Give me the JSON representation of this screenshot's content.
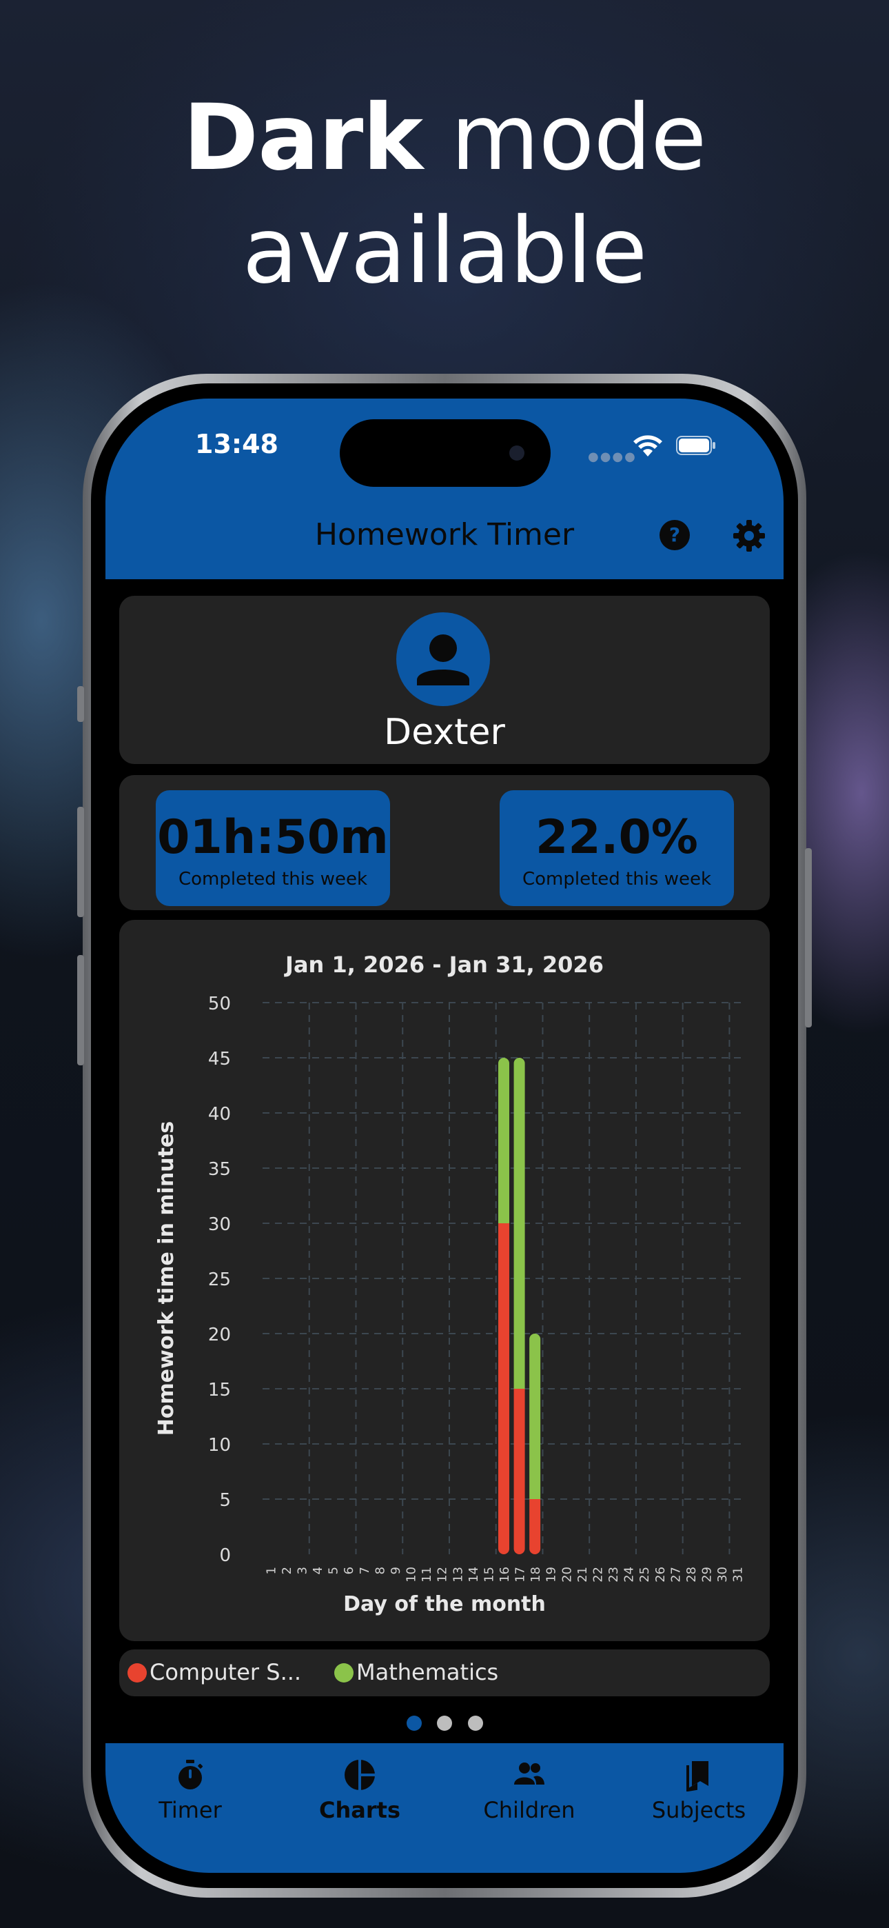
{
  "promo": {
    "headline_bold": "Dark",
    "headline_rest": " mode",
    "headline_line2": "available"
  },
  "status_bar": {
    "time": "13:48"
  },
  "header": {
    "title": "Homework Timer"
  },
  "profile": {
    "name": "Dexter"
  },
  "stats": [
    {
      "value": "01h:50m",
      "label": "Completed this week"
    },
    {
      "value": "22.0%",
      "label": "Completed this week"
    }
  ],
  "chart_data": {
    "type": "bar",
    "stacked": true,
    "title": "Jan 1, 2026 - Jan 31, 2026",
    "xlabel": "Day of the month",
    "ylabel": "Homework time in minutes",
    "ylim": [
      0,
      50
    ],
    "yticks": [
      0,
      5,
      10,
      15,
      20,
      25,
      30,
      35,
      40,
      45,
      50
    ],
    "categories": [
      "1",
      "2",
      "3",
      "4",
      "5",
      "6",
      "7",
      "8",
      "9",
      "10",
      "11",
      "12",
      "13",
      "14",
      "15",
      "16",
      "17",
      "18",
      "19",
      "20",
      "21",
      "22",
      "23",
      "24",
      "25",
      "26",
      "27",
      "28",
      "29",
      "30",
      "31"
    ],
    "series": [
      {
        "name": "Computer S...",
        "color": "#e8432f",
        "values": [
          0,
          0,
          0,
          0,
          0,
          0,
          0,
          0,
          0,
          0,
          0,
          0,
          0,
          0,
          0,
          30,
          15,
          5,
          0,
          0,
          0,
          0,
          0,
          0,
          0,
          0,
          0,
          0,
          0,
          0,
          0
        ]
      },
      {
        "name": "Mathematics",
        "color": "#8bc34a",
        "values": [
          0,
          0,
          0,
          0,
          0,
          0,
          0,
          0,
          0,
          0,
          0,
          0,
          0,
          0,
          0,
          15,
          30,
          15,
          0,
          0,
          0,
          0,
          0,
          0,
          0,
          0,
          0,
          0,
          0,
          0,
          0
        ]
      }
    ],
    "grid": true,
    "legend_position": "bottom"
  },
  "legend": [
    {
      "label": "Computer S...",
      "color": "#e8432f"
    },
    {
      "label": "Mathematics",
      "color": "#8bc34a"
    }
  ],
  "pager": {
    "count": 3,
    "active": 0
  },
  "tabs": [
    {
      "label": "Timer",
      "icon": "stopwatch-icon"
    },
    {
      "label": "Charts",
      "icon": "pie-chart-icon",
      "active": true
    },
    {
      "label": "Children",
      "icon": "people-icon"
    },
    {
      "label": "Subjects",
      "icon": "bookmarks-icon"
    }
  ],
  "colors": {
    "accent": "#0b57a4",
    "card": "#232323",
    "screen_bg": "#000000"
  }
}
